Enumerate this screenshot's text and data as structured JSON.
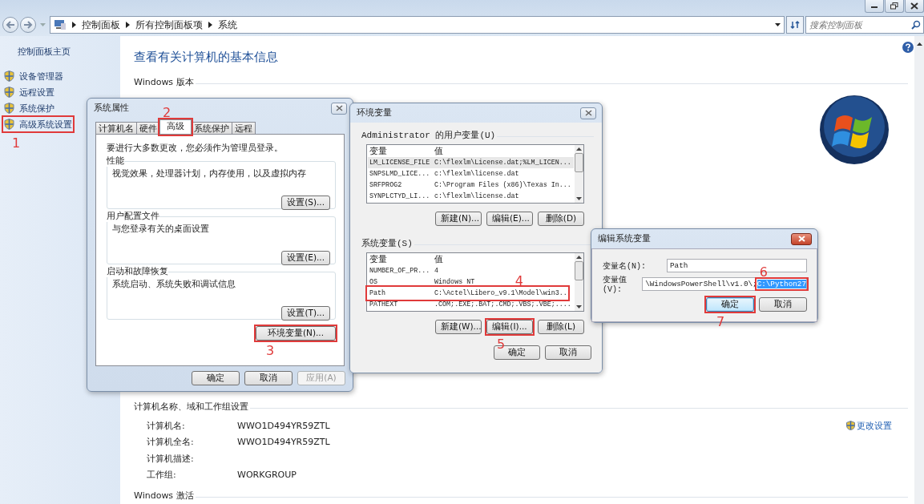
{
  "window": {
    "breadcrumb": [
      "控制面板",
      "所有控制面板项",
      "系统"
    ],
    "search": {
      "placeholder": "搜索控制面板"
    }
  },
  "sidebar": {
    "home": "控制面板主页",
    "items": [
      {
        "label": "设备管理器"
      },
      {
        "label": "远程设置"
      },
      {
        "label": "系统保护"
      },
      {
        "label": "高级系统设置",
        "callout": {
          "number": "1"
        }
      }
    ]
  },
  "main": {
    "title": "查看有关计算机的基本信息",
    "sections": [
      {
        "heading": "Windows 版本"
      },
      {
        "heading": "计算机名称、域和工作组设置",
        "rows": [
          {
            "label": "计算机名:",
            "value": "WWO1D494YR59ZTL"
          },
          {
            "label": "计算机全名:",
            "value": "WWO1D494YR59ZTL"
          },
          {
            "label": "计算机描述:"
          },
          {
            "label": "工作组:",
            "value": "WORKGROUP"
          }
        ],
        "link": "更改设置"
      },
      {
        "heading": "Windows 激活"
      }
    ]
  },
  "sys_props": {
    "title": "系统属性",
    "tabs": [
      {
        "label": "计算机名",
        "selected": false
      },
      {
        "label": "硬件",
        "selected": false
      },
      {
        "label": "高级",
        "selected": true,
        "callout": {
          "number": "2"
        }
      },
      {
        "label": "系统保护",
        "selected": false
      },
      {
        "label": "远程",
        "selected": false
      }
    ],
    "notice": "要进行大多数更改，您必须作为管理员登录。",
    "groups": [
      {
        "title": "性能",
        "description": "视觉效果，处理器计划，内存使用，以及虚拟内存",
        "button": "设置(S)..."
      },
      {
        "title": "用户配置文件",
        "description": "与您登录有关的桌面设置",
        "button": "设置(E)..."
      },
      {
        "title": "启动和故障恢复",
        "description": "系统启动、系统失败和调试信息",
        "button": "设置(T)..."
      }
    ],
    "env_button": {
      "label": "环境变量(N)...",
      "callout": {
        "number": "3"
      }
    },
    "buttons": [
      {
        "label": "确定",
        "disabled": false
      },
      {
        "label": "取消",
        "disabled": false
      },
      {
        "label": "应用(A)",
        "disabled": true
      }
    ]
  },
  "env_vars": {
    "title": "环境变量",
    "lists": [
      {
        "title": "Administrator 的用户变量(U)",
        "columns": [
          "变量",
          "值"
        ],
        "rows": [
          {
            "name": "LM_LICENSE_FILE",
            "value": "C:\\flexlm\\License.dat;%LM_LICEN...",
            "selected": true
          },
          {
            "name": "SNPSLMD_LICE...",
            "value": "c:\\flexlm\\license.dat",
            "selected": false
          },
          {
            "name": "SRFPROG2",
            "value": "C:\\Program Files (x86)\\Texas In...",
            "selected": false
          },
          {
            "name": "SYNPLCTYD_LI...",
            "value": "c:\\flexlm\\license.dat",
            "selected": false
          }
        ],
        "buttons": [
          {
            "label": "新建(N)..."
          },
          {
            "label": "编辑(E)..."
          },
          {
            "label": "删除(D)"
          }
        ]
      },
      {
        "title": "系统变量(S)",
        "columns": [
          "变量",
          "值"
        ],
        "rows": [
          {
            "name": "NUMBER_OF_PR...",
            "value": "4",
            "selected": false
          },
          {
            "name": "OS",
            "value": "Windows NT",
            "selected": false
          },
          {
            "name": "Path",
            "value": "C:\\Actel\\Libero_v9.1\\Model\\win3..",
            "selected": false,
            "callout": {
              "number": "4"
            }
          },
          {
            "name": "PATHEXT",
            "value": ".COM;.EXE;.BAT;.CMD;.VBS;.VBE;....",
            "selected": false
          }
        ],
        "buttons": [
          {
            "label": "新建(W)..."
          },
          {
            "label": "编辑(I)...",
            "callout": {
              "number": "5"
            }
          },
          {
            "label": "删除(L)"
          }
        ]
      }
    ],
    "buttons": [
      {
        "label": "确定"
      },
      {
        "label": "取消"
      }
    ]
  },
  "edit_var": {
    "title": "编辑系统变量",
    "name_field": {
      "label": "变量名(N):",
      "value": "Path"
    },
    "value_field": {
      "label": "变量值(V):",
      "value": "\\WindowsPowerShell\\v1.0\\;",
      "selection": "C:\\Python27",
      "callout": {
        "number": "6"
      }
    },
    "buttons": [
      {
        "label": "确定",
        "default": true,
        "callout": {
          "number": "7"
        }
      },
      {
        "label": "取消",
        "default": false
      }
    ]
  }
}
